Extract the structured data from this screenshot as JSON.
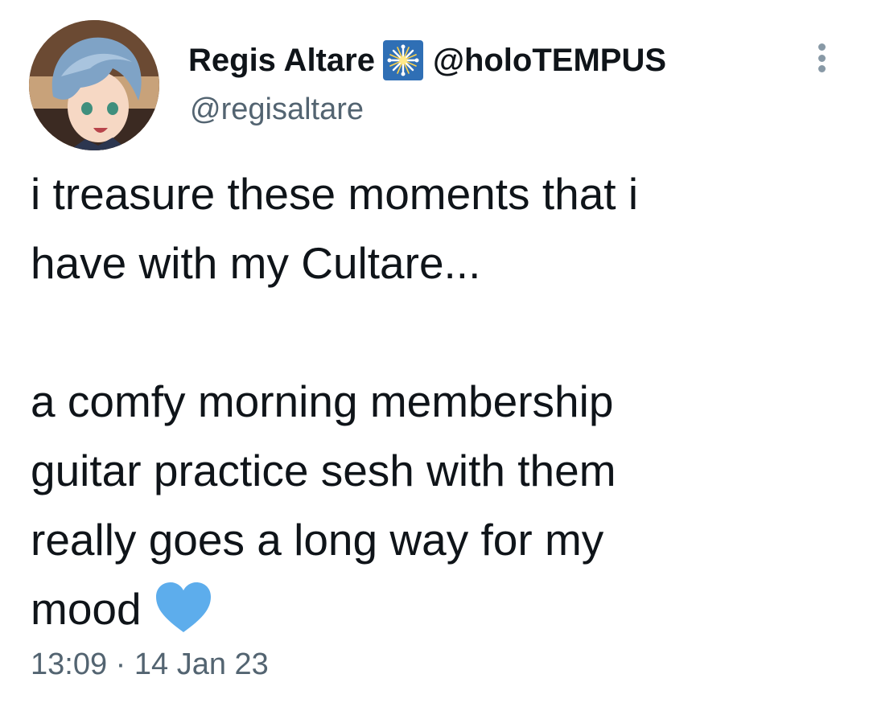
{
  "author": {
    "display_name": "Regis Altare",
    "affiliate_handle": "@holoTEMPUS",
    "handle": "@regisaltare",
    "avatar": "anime-avatar-blue-hair",
    "badge_icon": "affiliate-badge-icon",
    "badge_color": "#2f6fb5"
  },
  "tweet": {
    "lines": [
      "i treasure these moments that i",
      "have with my Cultare...",
      "",
      "a comfy morning membership",
      "guitar practice sesh with them",
      "really goes a long way for my",
      "mood"
    ],
    "emoji": "blue-heart-icon",
    "emoji_color": "#5dadec",
    "timestamp": "13:09 · 14 Jan 23"
  },
  "more_icon": "more-vertical-icon"
}
